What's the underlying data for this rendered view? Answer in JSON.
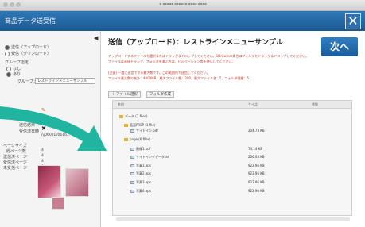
{
  "window": {
    "title": "▪ ▪▪▪▪▪ ▪▪▪▪▪▪ ▪▪▪▪ ▪▪▪▪"
  },
  "header": {
    "title": "商品データ送受信",
    "close_glyph": "✕"
  },
  "sidebar": {
    "collapse_glyph": "◀",
    "radio_send": "送信（アップロード）",
    "radio_receive": "受信（ダウンロード）",
    "group_label": "グループ指定",
    "group_none": "なし",
    "group_yes": "あり",
    "group_field_label": "グループ：",
    "group_value": "レストラインメニューサンプル",
    "status_label": "種別",
    "status_value": "",
    "received_label": "受信済件数",
    "send_result_label": "送信結果",
    "send_date_label": "受信済日時",
    "send_date_value": "nj0602D/0616...",
    "page_section": "ページサイズ",
    "page_total_label": "総ページ数",
    "page_total_value": "4",
    "page_in_label": "送信済ページ",
    "page_in_value": "4",
    "page_out_label": "受信済ページ",
    "page_out_value": "4",
    "page_unsent_label": "未受信ページ",
    "page_unsent_value": "0"
  },
  "main": {
    "title": "送信（アップロード）：レストラインメニューサンプル",
    "next_button": "次へ",
    "desc1": "アップロードするファイルを選択またはドラッグ＆ドロップしてください。1Drawinの場合はフォルダをドラッグ＆ドロップしてください。",
    "desc2": "ファイルは直接ドラッグ、フォルダを選ぶ方は、ビルベーシャン等を使いしてください。",
    "desc3": "[注意] 一度に送信できる最大数です。この範囲内で送信してください。",
    "desc4": "ファイル最大数の合計：4000MB、最大ファイル数：200、最大ファイル名：5、フォルダ階層：5",
    "add_file_button": "＋ ファイル選択",
    "folder_button": "フォルダ作成",
    "columns": {
      "name": "名前",
      "size": "サイズ",
      "status": "状態"
    }
  },
  "files": [
    {
      "name": "データ (7 files)",
      "size": "",
      "kind": "folder"
    },
    {
      "name": "画面PREP (1 file)",
      "size": "",
      "kind": "folder"
    },
    {
      "name": "サイトイン.pdf",
      "size": "204.73 KB",
      "kind": "file"
    },
    {
      "name": "page (6 files)",
      "size": "",
      "kind": "folder"
    },
    {
      "name": "画像1.pdf",
      "size": "74.14 KB",
      "kind": "file"
    },
    {
      "name": "サイトイングデータ.ai",
      "size": "206.03 KB",
      "kind": "file"
    },
    {
      "name": "写真1.eps",
      "size": "922.96 KB",
      "kind": "file"
    },
    {
      "name": "写真2.eps",
      "size": "922.96 KB",
      "kind": "file"
    },
    {
      "name": "写真3.eps",
      "size": "922.96 KB",
      "kind": "file"
    },
    {
      "name": "写真4.eps",
      "size": "922.96 KB",
      "kind": "file"
    }
  ],
  "colors": {
    "header": "#1d5a92",
    "accent": "#2f7fc2",
    "warn": "#c0392b",
    "arrow": "#1fb5a0"
  }
}
